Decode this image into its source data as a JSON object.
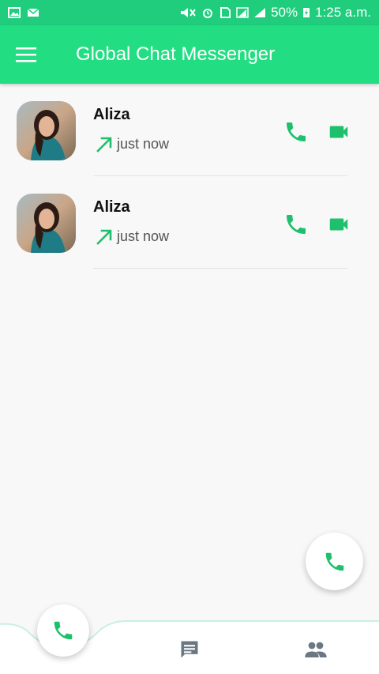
{
  "status_bar": {
    "battery": "50%",
    "time": "1:25 a.m."
  },
  "app_bar": {
    "title": "Global Chat Messenger",
    "menu_icon": "hamburger-menu-icon"
  },
  "calls": [
    {
      "name": "Aliza",
      "time": "just now",
      "direction_icon": "outgoing-arrow-icon"
    },
    {
      "name": "Aliza",
      "time": "just now",
      "direction_icon": "outgoing-arrow-icon"
    }
  ],
  "colors": {
    "accent": "#22dd82",
    "status_bar": "#1fcd7d",
    "icon_green": "#1fc06d",
    "icon_gray": "#6b7782"
  },
  "bottom_nav": {
    "items": [
      "phone-icon",
      "chat-icon",
      "people-icon"
    ]
  }
}
